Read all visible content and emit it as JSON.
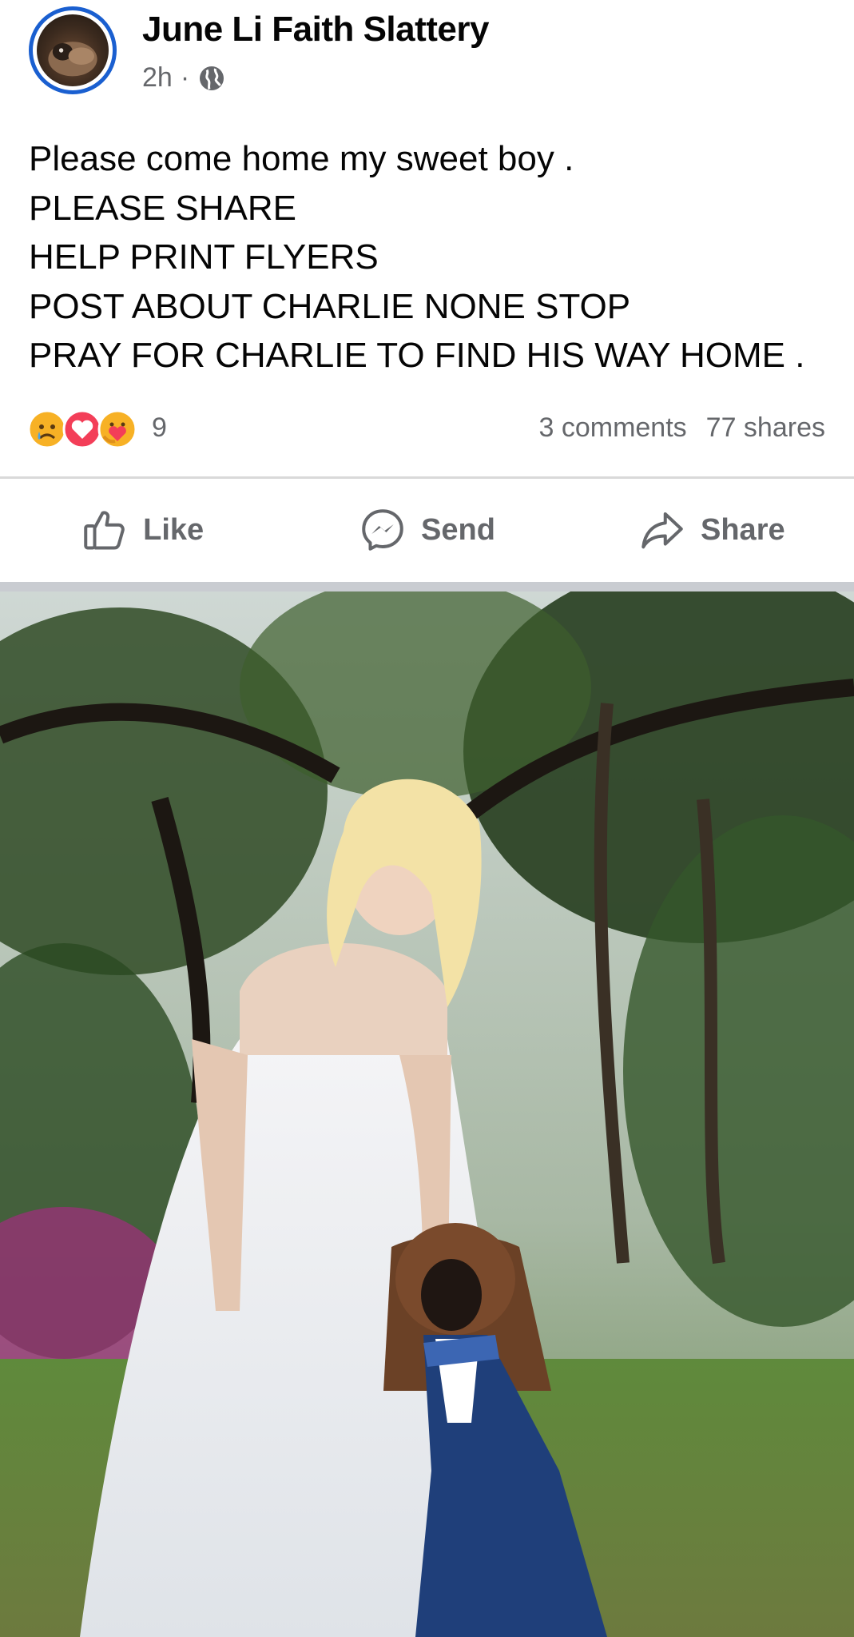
{
  "post": {
    "author": "June Li Faith Slattery",
    "time": "2h",
    "separator": "·",
    "audience_icon": "globe-icon",
    "text_lines": [
      "Please come home my sweet boy .",
      "PLEASE SHARE",
      "HELP PRINT FLYERS",
      "POST ABOUT CHARLIE NONE STOP",
      "PRAY FOR CHARLIE TO FIND HIS WAY HOME ."
    ],
    "reactions": {
      "icons": [
        "sad-reaction-icon",
        "love-reaction-icon",
        "care-reaction-icon"
      ],
      "count": "9"
    },
    "comments": "3 comments",
    "shares": "77 shares"
  },
  "actions": {
    "like": "Like",
    "send": "Send",
    "share": "Share"
  },
  "photo": {
    "description_icon": "photo"
  },
  "colors": {
    "accent": "#1a5fd0",
    "secondary_text": "#65676b",
    "love": "#f33e58",
    "emoji_yellow": "#f7b125"
  }
}
